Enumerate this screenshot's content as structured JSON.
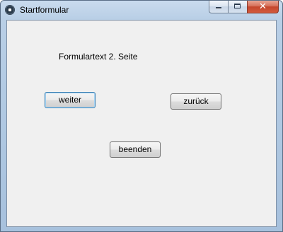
{
  "window": {
    "title": "Startformular",
    "icon": "app-icon",
    "controls": {
      "minimize_icon": "minimize-icon",
      "maximize_icon": "maximize-icon",
      "close_glyph": "✕"
    }
  },
  "form": {
    "label_text": "Formulartext 2. Seite",
    "buttons": {
      "weiter": "weiter",
      "zurueck": "zurück",
      "beenden": "beenden"
    }
  },
  "colors": {
    "frame": "#b9cfe6",
    "client_bg": "#f0f0f0",
    "close_button": "#c4452c",
    "default_button_border": "#3c7fb1"
  }
}
